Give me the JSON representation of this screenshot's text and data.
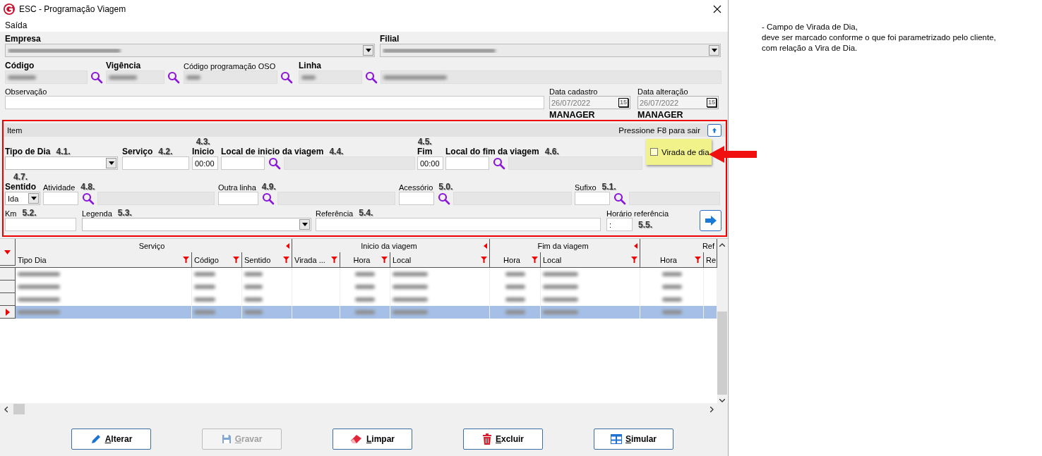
{
  "window": {
    "title": "ESC - Programação Viagem"
  },
  "menu": [
    {
      "label": "Saída"
    }
  ],
  "header": {
    "empresa": {
      "label": "Empresa"
    },
    "filial": {
      "label": "Filial"
    },
    "codigo": {
      "label": "Código"
    },
    "vigencia": {
      "label": "Vigência"
    },
    "codigo_oso": {
      "label": "Código programação OSO"
    },
    "linha": {
      "label": "Linha"
    },
    "observacao": {
      "label": "Observação"
    },
    "data_cadastro": {
      "label": "Data cadastro",
      "value": "26/07/2022",
      "calendar_day": "15",
      "user": "MANAGER"
    },
    "data_alteracao": {
      "label": "Data alteração",
      "value": "26/07/2022",
      "calendar_day": "15",
      "user": "MANAGER"
    }
  },
  "item_panel": {
    "title": "Item",
    "hint": "Pressione F8 para sair",
    "lines": [
      {
        "fields": [
          {
            "kind": "combo",
            "label": "Tipo de Dia",
            "bold": true,
            "marker": "4.1."
          },
          {
            "kind": "text",
            "label": "Serviço",
            "bold": true,
            "marker": "4.2."
          },
          {
            "kind": "text",
            "label": "Inicio",
            "bold": true,
            "value": "00:00",
            "marker_above": "4.3."
          },
          {
            "kind": "lookup",
            "label": "Local de inicio da viagem",
            "bold": true,
            "marker": "4.4."
          },
          {
            "kind": "text",
            "label": "Fim",
            "bold": true,
            "value": "00:00",
            "marker_above": "4.5."
          },
          {
            "kind": "lookup",
            "label": "Local do fim da viagem",
            "bold": true,
            "marker": "4.6."
          }
        ]
      },
      {
        "fields": [
          {
            "kind": "combo",
            "label": "Sentido",
            "bold": true,
            "value": "Ida",
            "marker_above": "4.7."
          },
          {
            "kind": "lookup",
            "label": "Atividade",
            "bold": false,
            "marker": "4.8."
          },
          {
            "kind": "lookup",
            "label": "Outra linha",
            "bold": false,
            "marker": "4.9."
          },
          {
            "kind": "lookup",
            "label": "Acessório",
            "bold": false,
            "marker": "5.0."
          },
          {
            "kind": "lookup",
            "label": "Sufixo",
            "bold": false,
            "marker": "5.1."
          }
        ]
      },
      {
        "fields": [
          {
            "kind": "text",
            "label": "Km",
            "bold": false,
            "marker": "5.2."
          },
          {
            "kind": "combo",
            "label": "Legenda",
            "bold": false,
            "marker": "5.3."
          },
          {
            "kind": "text",
            "label": "Referência",
            "bold": false,
            "marker": "5.4."
          },
          {
            "kind": "text",
            "label": "Horário referência",
            "bold": false,
            "value": ":",
            "marker_side": "5.5."
          }
        ]
      }
    ],
    "virada": {
      "label": "Virada de dia",
      "checked": false
    }
  },
  "grid": {
    "groups": [
      {
        "label": "Serviço",
        "collapse_arrow": true
      },
      {
        "label": "Inicio da viagem",
        "collapse_arrow": true
      },
      {
        "label": "Fim da viagem",
        "collapse_arrow": true
      },
      {
        "label": "Ref",
        "collapse_arrow": false
      }
    ],
    "columns": [
      {
        "label": "Tipo Dia",
        "filter": true
      },
      {
        "label": "Código",
        "filter": true
      },
      {
        "label": "Sentido",
        "filter": true
      },
      {
        "label": "Virada ...",
        "filter": true
      },
      {
        "label": "Hora",
        "filter": true
      },
      {
        "label": "Local",
        "filter": true
      },
      {
        "label": "Hora",
        "filter": true
      },
      {
        "label": "Local",
        "filter": true
      },
      {
        "label": "Hora",
        "filter": true
      },
      {
        "label": "Re"
      }
    ],
    "rows": [
      {
        "selected": false
      },
      {
        "selected": false
      },
      {
        "selected": false
      },
      {
        "selected": true
      }
    ]
  },
  "buttons": [
    {
      "label": "Alterar",
      "kind": "edit",
      "disabled": false
    },
    {
      "label": "Gravar",
      "kind": "save",
      "disabled": true
    },
    {
      "label": "Limpar",
      "kind": "clear",
      "disabled": false
    },
    {
      "label": "Excluir",
      "kind": "delete",
      "disabled": false
    },
    {
      "label": "Simular",
      "kind": "simulate",
      "disabled": false
    }
  ],
  "annotation": {
    "lines": [
      "- Campo de Virada de Dia,",
      "deve ser marcado conforme o que foi parametrizado pelo cliente,",
      "com relação a Vira de Dia."
    ]
  }
}
